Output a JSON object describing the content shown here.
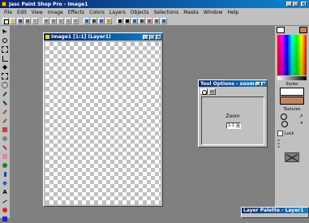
{
  "app": {
    "title": "Jasc Paint Shop Pro - Image1"
  },
  "menu": [
    "File",
    "Edit",
    "View",
    "Image",
    "Effects",
    "Colors",
    "Layers",
    "Objects",
    "Selections",
    "Masks",
    "Window",
    "Help"
  ],
  "image_window": {
    "title": "Image1 [1:1] (Layer1)"
  },
  "tool_options": {
    "title": "Tool Options - zoom",
    "zoom_label": "Zoom",
    "zoom_value": "1:1"
  },
  "palette": {
    "styles_label": "Styles",
    "textures_label": "Textures",
    "lock_label": "Lock"
  },
  "layer_palette": {
    "title": "Layer Palette - Layer1"
  },
  "colors": {
    "foreground": "#ffffff",
    "background": "#c48360",
    "accent": "#0a246a"
  }
}
